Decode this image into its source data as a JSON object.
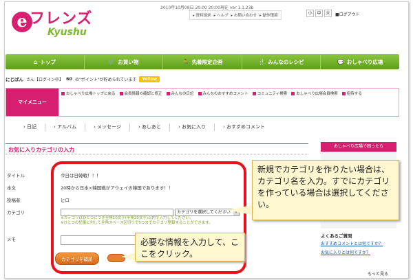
{
  "header": {
    "logo_e": "e",
    "logo_main": "フレンズ",
    "logo_sub": "Kyushu",
    "date_text": "2010年10月08日 20:00 20:00現在 ver 1.1.23b",
    "top_links": [
      "▸ 資料請求",
      "▸ ヘルプ",
      "▸ お問い合わせ",
      "▸ 動作環境"
    ],
    "size_buttons": [
      "小",
      "中",
      "大"
    ],
    "logout": "ログアウト"
  },
  "nav": [
    {
      "icon": "home-icon",
      "glyph": "⌂",
      "label": "トップ"
    },
    {
      "icon": "cart-icon",
      "glyph": "🛒",
      "label": "お買い物"
    },
    {
      "icon": "runner-icon",
      "glyph": "🏃",
      "label": "先着限定企画"
    },
    {
      "icon": "fork-knife-icon",
      "glyph": "🍴",
      "label": "みんなのレシピ"
    },
    {
      "icon": "chat-icon",
      "glyph": "💬",
      "label": "おしゃべり広場"
    }
  ],
  "user": {
    "name": "にじばん",
    "status": "さん【ログイン中】",
    "points": "60",
    "points_note": "の\"ポイント\"が貯められています",
    "badge": "Yellow"
  },
  "mymenu": {
    "label": "マイメニュー",
    "links": [
      "おしゃべり広場トップに戻る",
      "会員情報の確認と修正",
      "みんなの日記",
      "みんなのおすすめコメント",
      "コミュニティ検索",
      "おしゃべり広場会員検索",
      "招待する"
    ]
  },
  "subnav": [
    "日記",
    "アルバム",
    "メッセージ",
    "あしあと",
    "お気に入り",
    "おすすめコメント"
  ],
  "section_title": "お気に入りカテゴリの入力",
  "form": {
    "title_label": "タイトル",
    "title_value": "今日は日韓戦！！！",
    "body_label": "本文",
    "body_value": "20時から日本×韓国戦がアウェイの韓国であります！！",
    "poster_label": "投稿者",
    "poster_value": "ヒロ",
    "category_label": "カテゴリ",
    "category_select": "カテゴリを選択してください",
    "note1": "※カテゴリはひとつにつき全角10文字(半角20文字)以内で入力してください。",
    "note2": "※ひとつの記事に対して全角スペース区切りで5つまでカテゴリ登録することができます。",
    "memo_label": "メモ",
    "confirm_button": "カテゴリを確認"
  },
  "sidebar": {
    "header": "おしゃべり広場で困ったら",
    "faq_title": "よくあるご質問",
    "faq": [
      "おすすめコメントとは何ですか？",
      "お気に入りとは何ですか？"
    ],
    "more": "もっと見る"
  },
  "callouts": {
    "c1": "新規でカテゴリを作りたい場合は、カテゴリ名を入力。すでにカテゴリを作っている場合は選択してください。",
    "c2": "必要な情報を入力して、ここをクリック。"
  }
}
